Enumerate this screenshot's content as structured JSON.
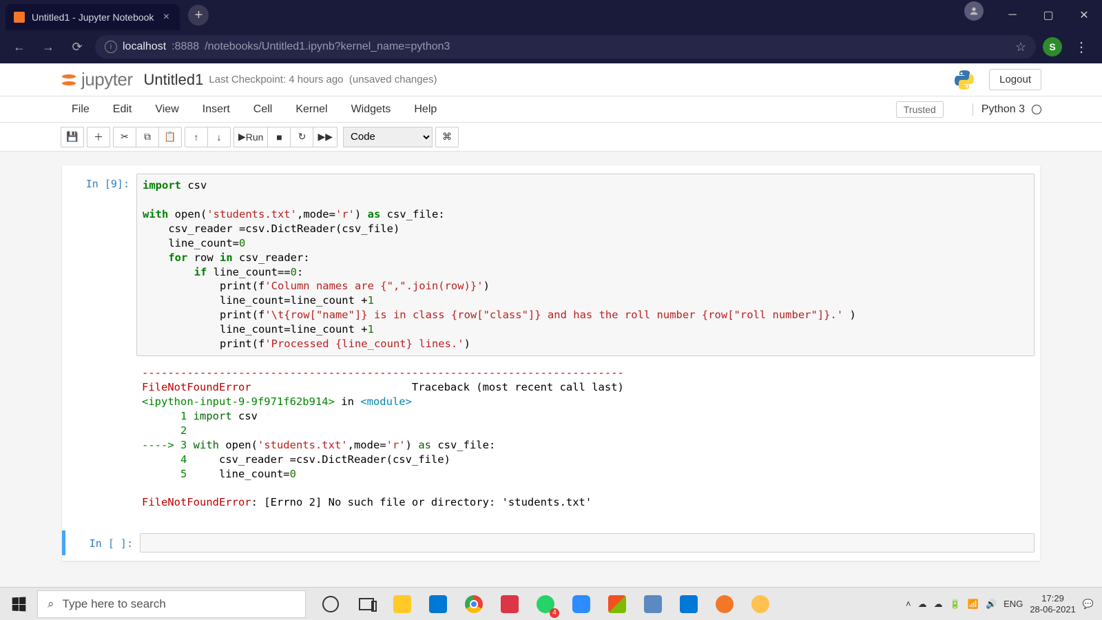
{
  "browser": {
    "tab_title": "Untitled1 - Jupyter Notebook",
    "url_host": "localhost",
    "url_port": ":8888",
    "url_path": "/notebooks/Untitled1.ipynb?kernel_name=python3",
    "profile_letter": "S"
  },
  "jupyter": {
    "logo_text": "jupyter",
    "notebook_name": "Untitled1",
    "checkpoint": "Last Checkpoint: 4 hours ago",
    "unsaved": "(unsaved changes)",
    "logout": "Logout",
    "menus": [
      "File",
      "Edit",
      "View",
      "Insert",
      "Cell",
      "Kernel",
      "Widgets",
      "Help"
    ],
    "trusted": "Trusted",
    "kernel": "Python 3",
    "run_label": "Run",
    "cell_type": "Code"
  },
  "cells": {
    "c0": {
      "prompt": "In [9]:",
      "code_lines": [
        [
          [
            "kw",
            "import"
          ],
          [
            "",
            ""
          ],
          [
            "plain",
            " csv"
          ]
        ],
        [
          [
            "plain",
            ""
          ]
        ],
        [
          [
            "kw",
            "with"
          ],
          [
            "plain",
            " open("
          ],
          [
            "str",
            "'students.txt'"
          ],
          [
            "plain",
            ",mode="
          ],
          [
            "str",
            "'r'"
          ],
          [
            "plain",
            ") "
          ],
          [
            "kw",
            "as"
          ],
          [
            "plain",
            " csv_file:"
          ]
        ],
        [
          [
            "plain",
            "    csv_reader =csv.DictReader(csv_file)"
          ]
        ],
        [
          [
            "plain",
            "    line_count="
          ],
          [
            "num",
            "0"
          ]
        ],
        [
          [
            "plain",
            "    "
          ],
          [
            "kw",
            "for"
          ],
          [
            "plain",
            " row "
          ],
          [
            "kw",
            "in"
          ],
          [
            "plain",
            " csv_reader:"
          ]
        ],
        [
          [
            "plain",
            "        "
          ],
          [
            "kw",
            "if"
          ],
          [
            "plain",
            " line_count=="
          ],
          [
            "num",
            "0"
          ],
          [
            "plain",
            ":"
          ]
        ],
        [
          [
            "plain",
            "            print(f"
          ],
          [
            "str",
            "'Column names are {\",\".join(row)}'"
          ],
          [
            "plain",
            ")"
          ]
        ],
        [
          [
            "plain",
            "            line_count=line_count +"
          ],
          [
            "num",
            "1"
          ]
        ],
        [
          [
            "plain",
            "            print(f"
          ],
          [
            "str",
            "'\\t{row[\"name\"]} is in class {row[\"class\"]} and has the roll number {row[\"roll number\"]}.'"
          ],
          [
            "plain",
            " )"
          ]
        ],
        [
          [
            "plain",
            "            line_count=line_count +"
          ],
          [
            "num",
            "1"
          ]
        ],
        [
          [
            "plain",
            "            print(f"
          ],
          [
            "str",
            "'Processed {line_count} lines.'"
          ],
          [
            "plain",
            ")"
          ]
        ]
      ],
      "output_lines": [
        [
          [
            "ansi-red",
            "---------------------------------------------------------------------------"
          ]
        ],
        [
          [
            "ansi-red",
            "FileNotFoundError"
          ],
          [
            "plain",
            "                         Traceback (most recent call last)"
          ]
        ],
        [
          [
            "ansi-green",
            "<ipython-input-9-9f971f62b914>"
          ],
          [
            "plain",
            " in "
          ],
          [
            "ansi-cyan",
            "<module>"
          ]
        ],
        [
          [
            "ansi-green",
            "      1 "
          ],
          [
            "ansi-darkgreen",
            "import"
          ],
          [
            "plain",
            " csv"
          ]
        ],
        [
          [
            "ansi-green",
            "      2 "
          ]
        ],
        [
          [
            "ansi-green",
            "----> 3 "
          ],
          [
            "ansi-darkgreen",
            "with"
          ],
          [
            "plain",
            " open("
          ],
          [
            "str",
            "'students.txt'"
          ],
          [
            "plain",
            ",mode="
          ],
          [
            "str",
            "'r'"
          ],
          [
            "plain",
            ") "
          ],
          [
            "ansi-darkgreen",
            "as"
          ],
          [
            "plain",
            " csv_file:"
          ]
        ],
        [
          [
            "ansi-green",
            "      4 "
          ],
          [
            "plain",
            "    csv_reader =csv.DictReader(csv_file)"
          ]
        ],
        [
          [
            "ansi-green",
            "      5 "
          ],
          [
            "plain",
            "    line_count="
          ],
          [
            "num",
            "0"
          ]
        ],
        [
          [
            "plain",
            ""
          ]
        ],
        [
          [
            "ansi-red",
            "FileNotFoundError"
          ],
          [
            "plain",
            ": [Errno 2] No such file or directory: 'students.txt'"
          ]
        ]
      ]
    },
    "c1": {
      "prompt": "In [ ]:"
    }
  },
  "taskbar": {
    "search_placeholder": "Type here to search",
    "wa_badge": "4",
    "lang": "ENG",
    "time": "17:29",
    "date": "28-06-2021"
  }
}
